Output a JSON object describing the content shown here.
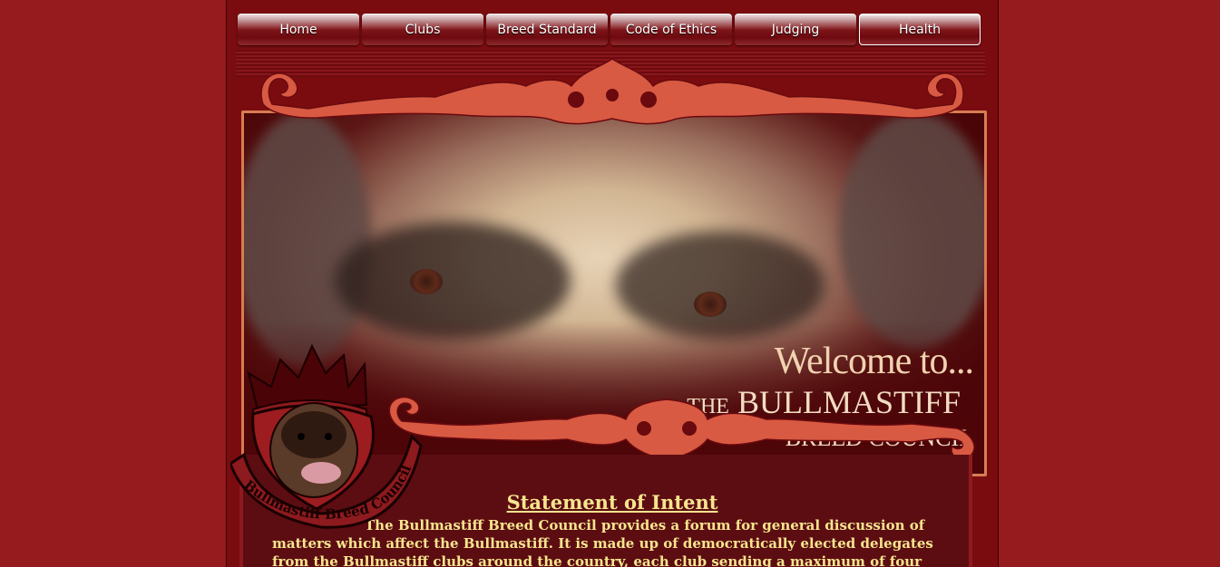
{
  "nav": {
    "items": [
      {
        "label": "Home"
      },
      {
        "label": "Clubs"
      },
      {
        "label": "Breed Standard"
      },
      {
        "label": "Code of Ethics"
      },
      {
        "label": "Judging"
      },
      {
        "label": "Health"
      }
    ],
    "active": "Health"
  },
  "banner": {
    "welcome": "Welcome to...",
    "title_the": "THE",
    "title_name": "BULLMASTIFF",
    "title_sub": "BREED COUNCIL"
  },
  "logo": {
    "banner_text": "Bullmastiff Breed Council"
  },
  "statement": {
    "title": "Statement of Intent",
    "text": "The Bullmastiff Breed Council provides a forum for general discussion of matters which affect the Bullmastiff. It is made up of democratically elected delegates from the Bullmastiff clubs around the country, each club sending a maximum of four representatives to join in the discussions"
  },
  "colors": {
    "background": "#951b1e",
    "page": "#7a0c10",
    "accent": "#d85a43",
    "text_highlight": "#f6e58d"
  }
}
